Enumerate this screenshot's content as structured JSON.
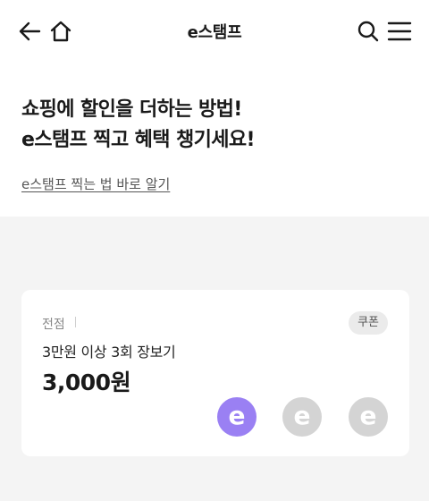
{
  "header": {
    "title": "e스탬프",
    "icons": [
      "back-arrow-icon",
      "home-icon",
      "search-icon",
      "hamburger-menu-icon"
    ]
  },
  "hero": {
    "line1": "쇼핑에 할인을 더하는 방법!",
    "line2": "e스탬프 찍고 혜택 챙기세요!",
    "link": "e스탬프 찍는 법 바로 알기"
  },
  "card": {
    "store": "전점",
    "badge": "쿠폰",
    "condition": "3만원 이상 3회 장보기",
    "amount": "3,000원",
    "stamps": [
      {
        "letter": "e",
        "state": "filled",
        "color": "#9a80f3"
      },
      {
        "letter": "e",
        "state": "empty",
        "color": "#d4d4d4"
      },
      {
        "letter": "e",
        "state": "empty",
        "color": "#d4d4d4"
      }
    ]
  },
  "colors": {
    "accent": "#9a80f3",
    "background_gray": "#f4f4f4",
    "stamp_empty": "#d4d4d4"
  }
}
